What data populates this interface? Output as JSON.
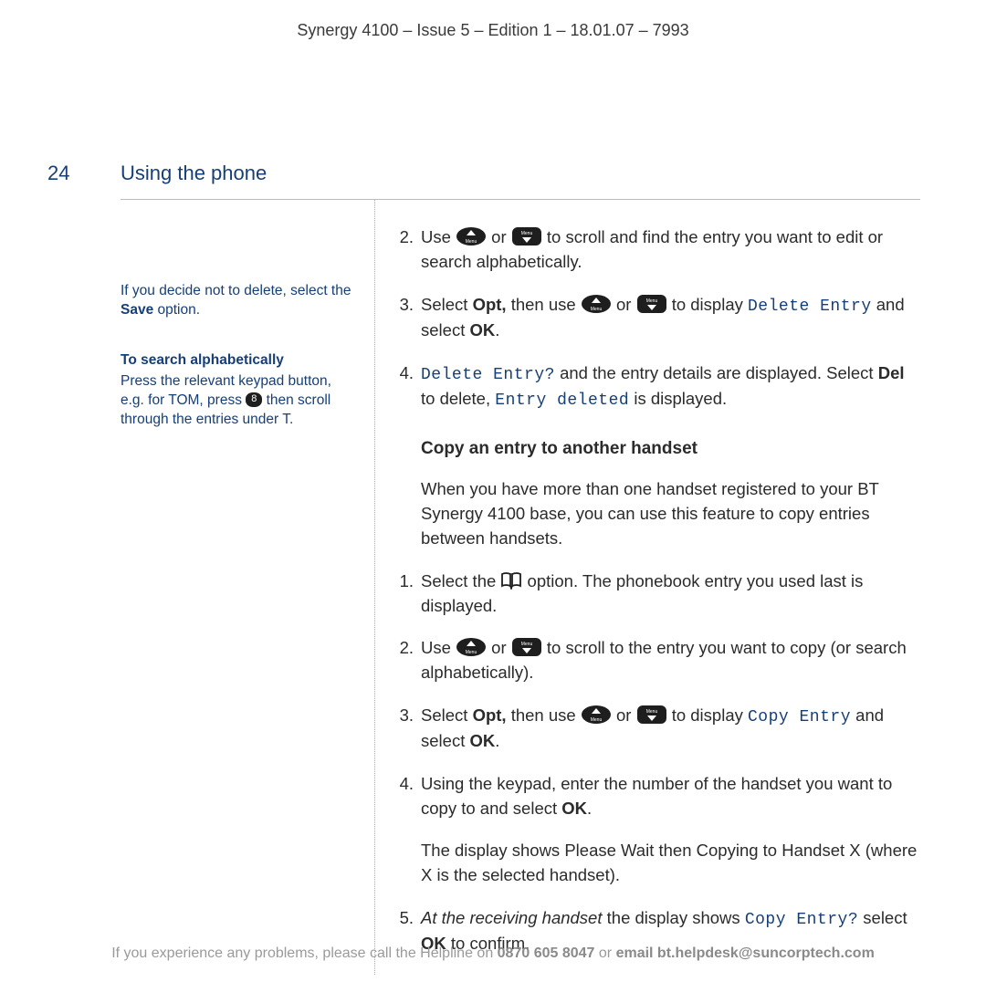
{
  "header": "Synergy 4100 – Issue 5 – Edition 1 – 18.01.07 – 7993",
  "page_number": "24",
  "section_title": "Using the phone",
  "sidebar": {
    "tip1_a": "If you decide not to delete, select the ",
    "tip1_b": "Save",
    "tip1_c": " option.",
    "tip2_title": "To search alphabetically",
    "tip2_a": "Press the relevant keypad button, e.g. for TOM, press ",
    "tip2_key": "8",
    "tip2_b": " then scroll through the entries under T."
  },
  "steps_a": {
    "s2": {
      "n": "2.",
      "a": "Use ",
      "or": " or ",
      "b": " to scroll and find the entry you want to edit or search alphabetically."
    },
    "s3": {
      "n": "3.",
      "a": "Select ",
      "opt": "Opt,",
      "b": " then use ",
      "or": " or ",
      "c": " to display ",
      "lcd": "Delete Entry",
      "d": " and select ",
      "ok": "OK",
      "e": "."
    },
    "s4": {
      "n": "4.",
      "lcd1": "Delete Entry?",
      "a": " and the entry details are displayed. Select ",
      "del": "Del",
      "b": " to delete, ",
      "lcd2": "Entry deleted",
      "c": " is displayed."
    }
  },
  "subhead": "Copy an entry to another handset",
  "intro": "When you have more than one handset registered to your BT Synergy 4100 base, you can use this feature to copy entries between handsets.",
  "steps_b": {
    "s1": {
      "n": "1.",
      "a": "Select the ",
      "b": " option. The phonebook entry you used last is displayed."
    },
    "s2": {
      "n": "2.",
      "a": "Use ",
      "or": " or ",
      "b": " to scroll to the entry you want to copy (or search alphabetically)."
    },
    "s3": {
      "n": "3.",
      "a": "Select ",
      "opt": "Opt,",
      "b": " then use ",
      "or": " or ",
      "c": " to display ",
      "lcd": "Copy Entry",
      "d": " and select ",
      "ok": "OK",
      "e": "."
    },
    "s4": {
      "n": "4.",
      "a": "Using the keypad, enter the number of the handset you want to copy to and select ",
      "ok": "OK",
      "b": "."
    },
    "extra": {
      "a": "The display shows ",
      "lcd1": "Please Wait",
      "b": " then ",
      "lcd2": "Copying to Handset X",
      "c": " (where X is the selected handset)."
    },
    "s5": {
      "n": "5.",
      "ital": "At the receiving handset",
      "a": " the display shows ",
      "lcd": "Copy Entry?",
      "b": " select ",
      "ok": "OK",
      "c": " to confirm."
    }
  },
  "footer": {
    "a": "If you experience any problems, please call the Helpline on ",
    "phone": "0870 605 8047",
    "b": " or ",
    "email": "email bt.helpdesk@suncorptech.com"
  }
}
